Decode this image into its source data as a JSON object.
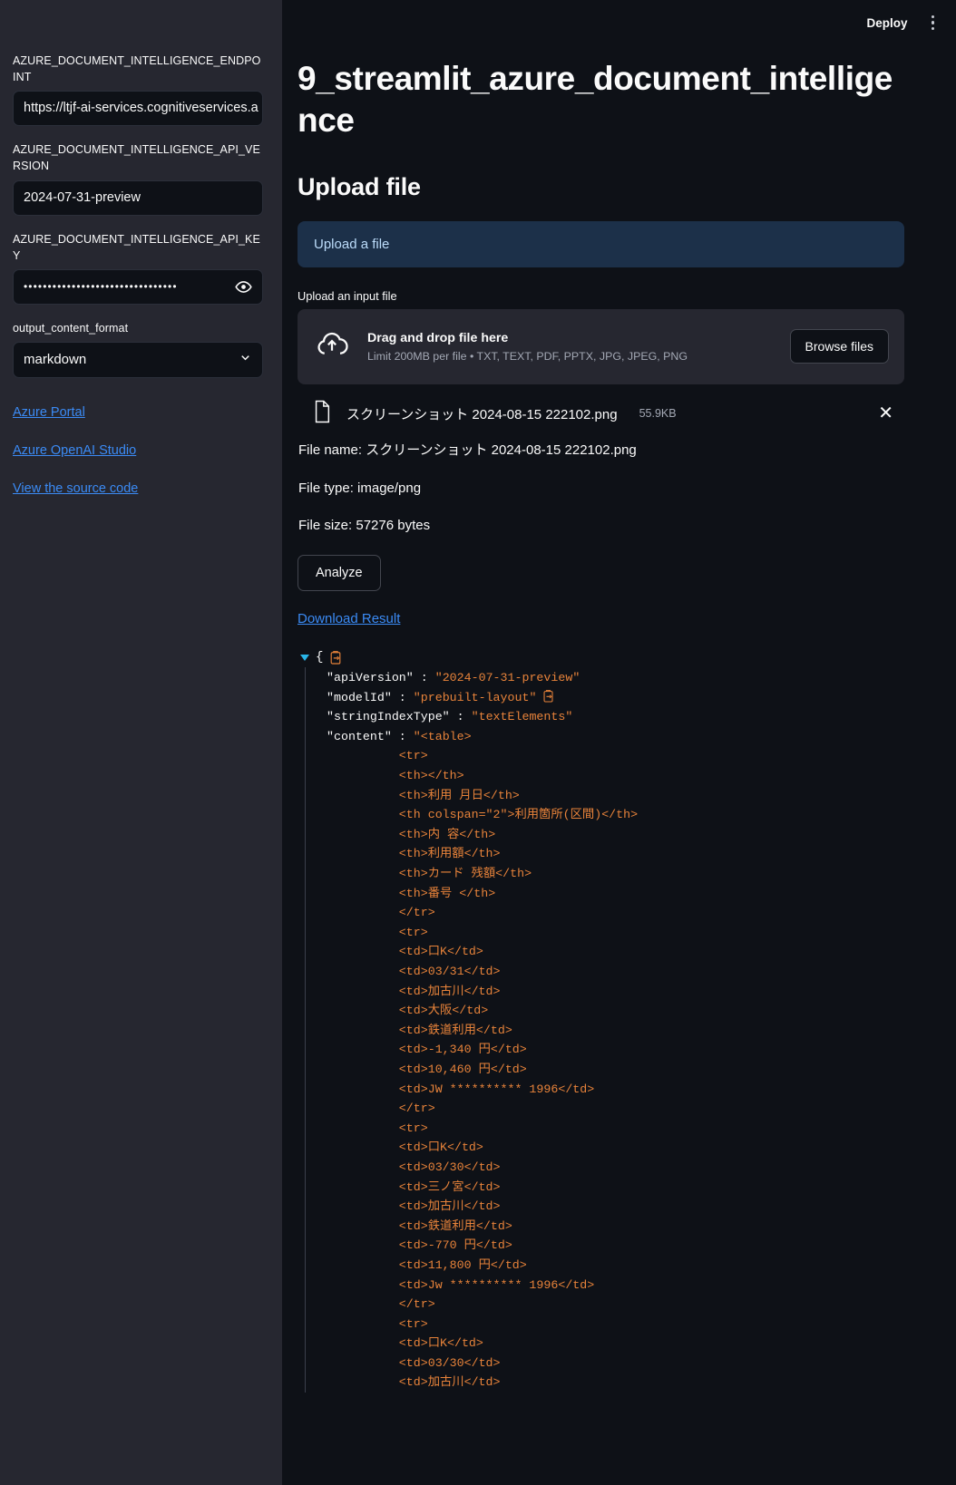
{
  "sidebar": {
    "fields": [
      {
        "label": "AZURE_DOCUMENT_INTELLIGENCE_ENDPOINT",
        "value": "https://ltjf-ai-services.cognitiveservices.a"
      },
      {
        "label": "AZURE_DOCUMENT_INTELLIGENCE_API_VERSION",
        "value": "2024-07-31-preview"
      },
      {
        "label": "AZURE_DOCUMENT_INTELLIGENCE_API_KEY",
        "value": "••••••••••••••••••••••••••••••••"
      }
    ],
    "select": {
      "label": "output_content_format",
      "value": "markdown"
    },
    "links": [
      {
        "label": "Azure Portal"
      },
      {
        "label": "Azure OpenAI Studio"
      },
      {
        "label": "View the source code"
      }
    ]
  },
  "topbar": {
    "deploy_label": "Deploy"
  },
  "main": {
    "title": "9_streamlit_azure_document_intelligence",
    "section_title": "Upload file",
    "info_text": "Upload a file",
    "uploader_label": "Upload an input file",
    "dropzone": {
      "main": "Drag and drop file here",
      "sub": "Limit 200MB per file • TXT, TEXT, PDF, PPTX, JPG, JPEG, PNG",
      "browse_label": "Browse files"
    },
    "uploaded_file": {
      "name": "スクリーンショット 2024-08-15 222102.png",
      "size": "55.9KB",
      "close_label": "✕"
    },
    "file_name_line": "File name: スクリーンショット 2024-08-15 222102.png",
    "file_type_line": "File type: image/png",
    "file_size_line": "File size: 57276 bytes",
    "analyze_label": "Analyze",
    "download_label": "Download Result"
  },
  "json_result": {
    "open_brace": "{",
    "rows": [
      {
        "key": "\"apiVersion\"",
        "colon": " : ",
        "value": "\"2024-07-31-preview\"",
        "copy": false
      },
      {
        "key": "\"modelId\"",
        "colon": " : ",
        "value": "\"prebuilt-layout\"",
        "copy": true
      },
      {
        "key": "\"stringIndexType\"",
        "colon": " : ",
        "value": "\"textElements\"",
        "copy": false
      }
    ],
    "content_key": "\"content\"",
    "content_colon": " : ",
    "content_value": "\"<table>\n          <tr>\n          <th></th>\n          <th>利用 月日</th>\n          <th colspan=\"2\">利用箇所(区間)</th>\n          <th>内 容</th>\n          <th>利用額</th>\n          <th>カード 残額</th>\n          <th>番号 </th>\n          </tr>\n          <tr>\n          <td>口K</td>\n          <td>03/31</td>\n          <td>加古川</td>\n          <td>大阪</td>\n          <td>鉄道利用</td>\n          <td>-1,340 円</td>\n          <td>10,460 円</td>\n          <td>JW ********** 1996</td>\n          </tr>\n          <tr>\n          <td>口K</td>\n          <td>03/30</td>\n          <td>三ノ宮</td>\n          <td>加古川</td>\n          <td>鉄道利用</td>\n          <td>-770 円</td>\n          <td>11,800 円</td>\n          <td>Jw ********** 1996</td>\n          </tr>\n          <tr>\n          <td>口K</td>\n          <td>03/30</td>\n          <td>加古川</td>"
  },
  "colors": {
    "sidebar_bg": "#262730",
    "main_bg": "#0e1117",
    "accent_link": "#3b8bf5",
    "info_bg": "#1c3049",
    "json_string": "#e8833a",
    "caret": "#29b5e8"
  }
}
